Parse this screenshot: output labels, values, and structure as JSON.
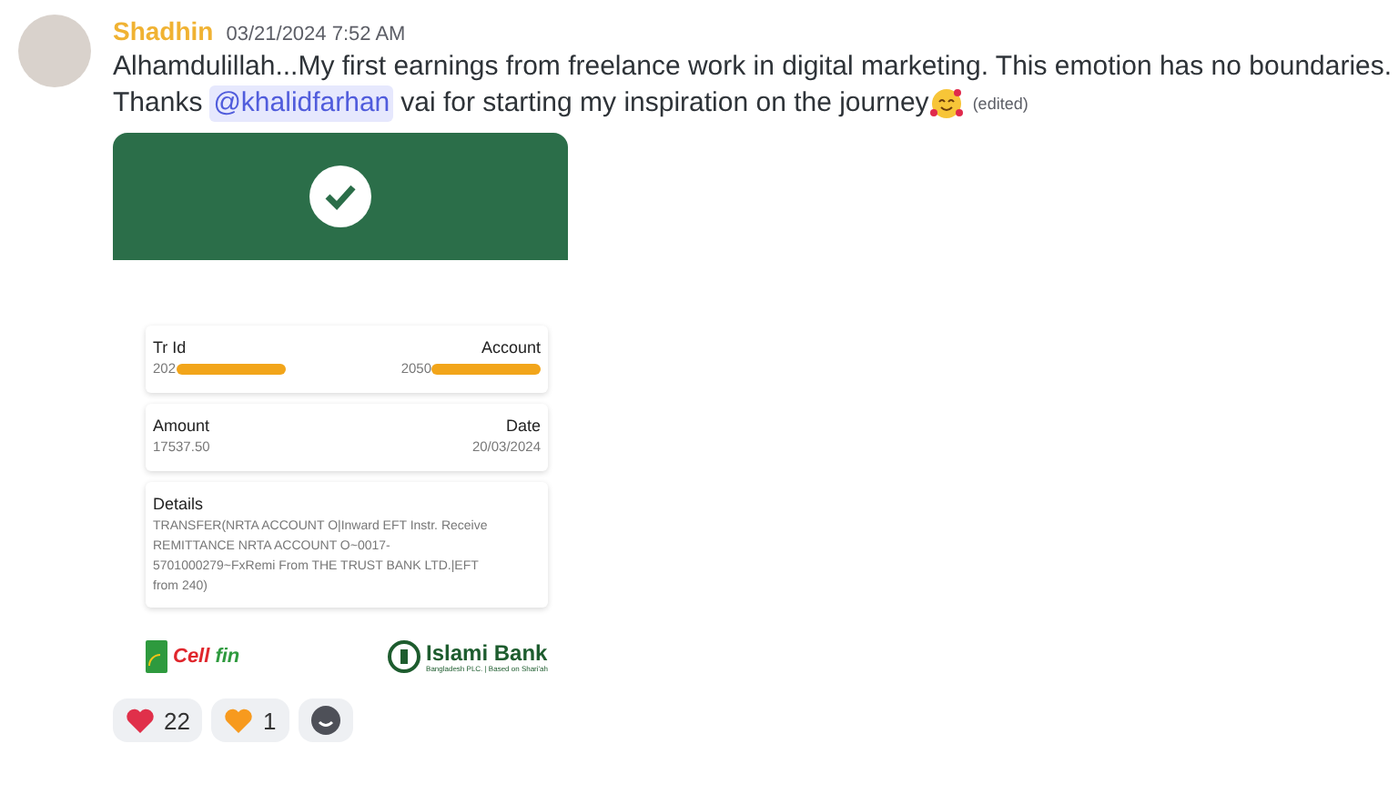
{
  "message": {
    "author": "Shadhin",
    "timestamp": "03/21/2024 7:52 AM",
    "line_1": "Alhamdulillah...My first earnings from freelance work in digital marketing.  This emotion has no boundaries.",
    "line_2_before": "Thanks",
    "mention": "@khalidfarhan",
    "line_2_after": "vai for starting my inspiration on the journey",
    "edited": "(edited)"
  },
  "receipt": {
    "cards": [
      {
        "left_label": "Tr Id",
        "left_value": "202",
        "right_label": "Account",
        "right_value": "2050",
        "redacted": true
      },
      {
        "left_label": "Amount",
        "left_value": "17537.50",
        "right_label": "Date",
        "right_value": "20/03/2024",
        "redacted": false
      }
    ],
    "details_label": "Details",
    "details_text": "TRANSFER(NRTA ACCOUNT O|Inward EFT Instr. Receive REMITTANCE NRTA ACCOUNT O~0017-5701000279~FxRemi From THE TRUST BANK LTD.|EFT from 240)",
    "logo_left_a": "Cell",
    "logo_left_b": "fin",
    "logo_right": "Islami Bank",
    "logo_right_sub": "Bangladesh PLC. | Based on Shari'ah"
  },
  "reactions": [
    {
      "kind": "heart",
      "color": "#e0304a",
      "count": "22"
    },
    {
      "kind": "heart",
      "color": "#f79a1e",
      "count": "1"
    },
    {
      "kind": "add"
    }
  ]
}
